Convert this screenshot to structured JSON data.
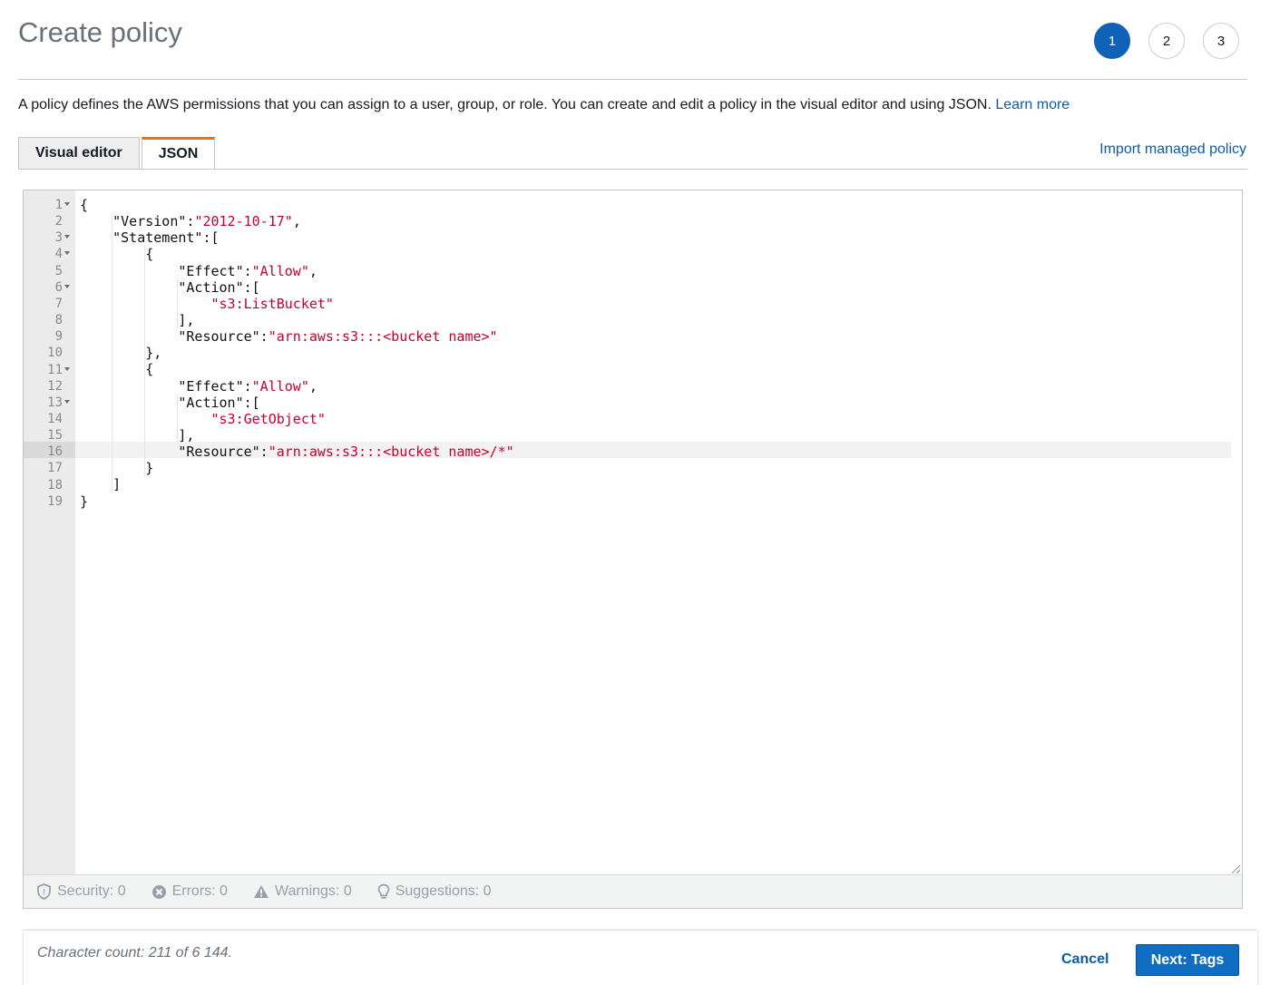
{
  "header": {
    "title": "Create policy",
    "steps": [
      "1",
      "2",
      "3"
    ],
    "active_step": "1"
  },
  "description": {
    "text": "A policy defines the AWS permissions that you can assign to a user, group, or role. You can create and edit a policy in the visual editor and using JSON.",
    "learn_more": "Learn more"
  },
  "tabs": {
    "visual_editor": "Visual editor",
    "json": "JSON",
    "active": "JSON"
  },
  "import_link": "Import managed policy",
  "editor": {
    "line_numbers": [
      "1",
      "2",
      "3",
      "4",
      "5",
      "6",
      "7",
      "8",
      "9",
      "10",
      "11",
      "12",
      "13",
      "14",
      "15",
      "16",
      "17",
      "18",
      "19"
    ],
    "foldable_lines": [
      "1",
      "3",
      "4",
      "6",
      "11",
      "13"
    ],
    "active_line": "16",
    "code_lines": [
      "{",
      "    \"Version\":\"2012-10-17\",",
      "    \"Statement\":[",
      "        {",
      "            \"Effect\":\"Allow\",",
      "            \"Action\":[",
      "                \"s3:ListBucket\"",
      "            ],",
      "            \"Resource\":\"arn:aws:s3:::<bucket name>\"",
      "        },",
      "        {",
      "            \"Effect\":\"Allow\",",
      "            \"Action\":[",
      "                \"s3:GetObject\"",
      "            ],",
      "            \"Resource\":\"arn:aws:s3:::<bucket name>/*\"",
      "        }",
      "    ]",
      "}"
    ]
  },
  "status_bar": {
    "security": "Security: 0",
    "errors": "Errors: 0",
    "warnings": "Warnings: 0",
    "suggestions": "Suggestions: 0"
  },
  "footer": {
    "char_count": "Character count: 211 of 6 144.",
    "cancel": "Cancel",
    "next": "Next: Tags"
  },
  "colors": {
    "primary": "#0f62b6",
    "link": "#0a5bab",
    "tab_accent": "#ec7211",
    "string": "#c7002e"
  }
}
